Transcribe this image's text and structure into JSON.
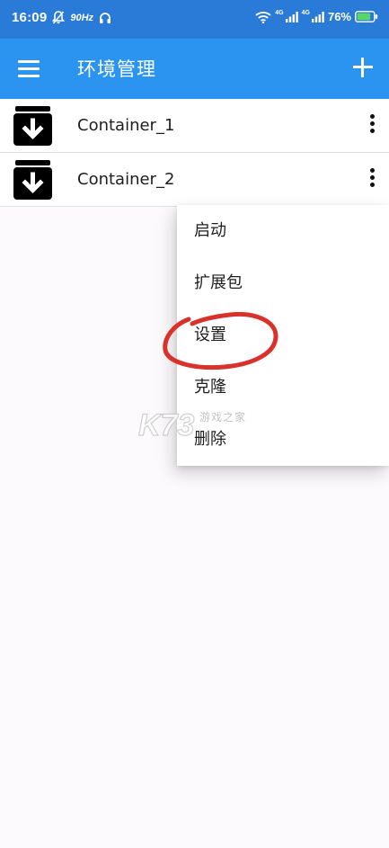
{
  "status_bar": {
    "time": "16:09",
    "refresh_rate": "90Hz",
    "network_1": "4G",
    "network_2": "4G",
    "battery": "76%"
  },
  "app_bar": {
    "title": "环境管理",
    "menu_icon": "hamburger-menu-icon",
    "add_icon": "plus-icon"
  },
  "containers": [
    {
      "name": "Container_1",
      "icon": "archive-download-icon"
    },
    {
      "name": "Container_2",
      "icon": "archive-download-icon"
    }
  ],
  "context_menu": {
    "items": [
      "启动",
      "扩展包",
      "设置",
      "克隆",
      "删除"
    ],
    "highlighted": "设置"
  },
  "watermark": {
    "text": "K73",
    "subtext": "游戏之家"
  },
  "colors": {
    "status_bar": "#2A7AD8",
    "app_bar": "#2A94F0",
    "annotation": "#D9322B",
    "background": "#FCFAFC"
  }
}
